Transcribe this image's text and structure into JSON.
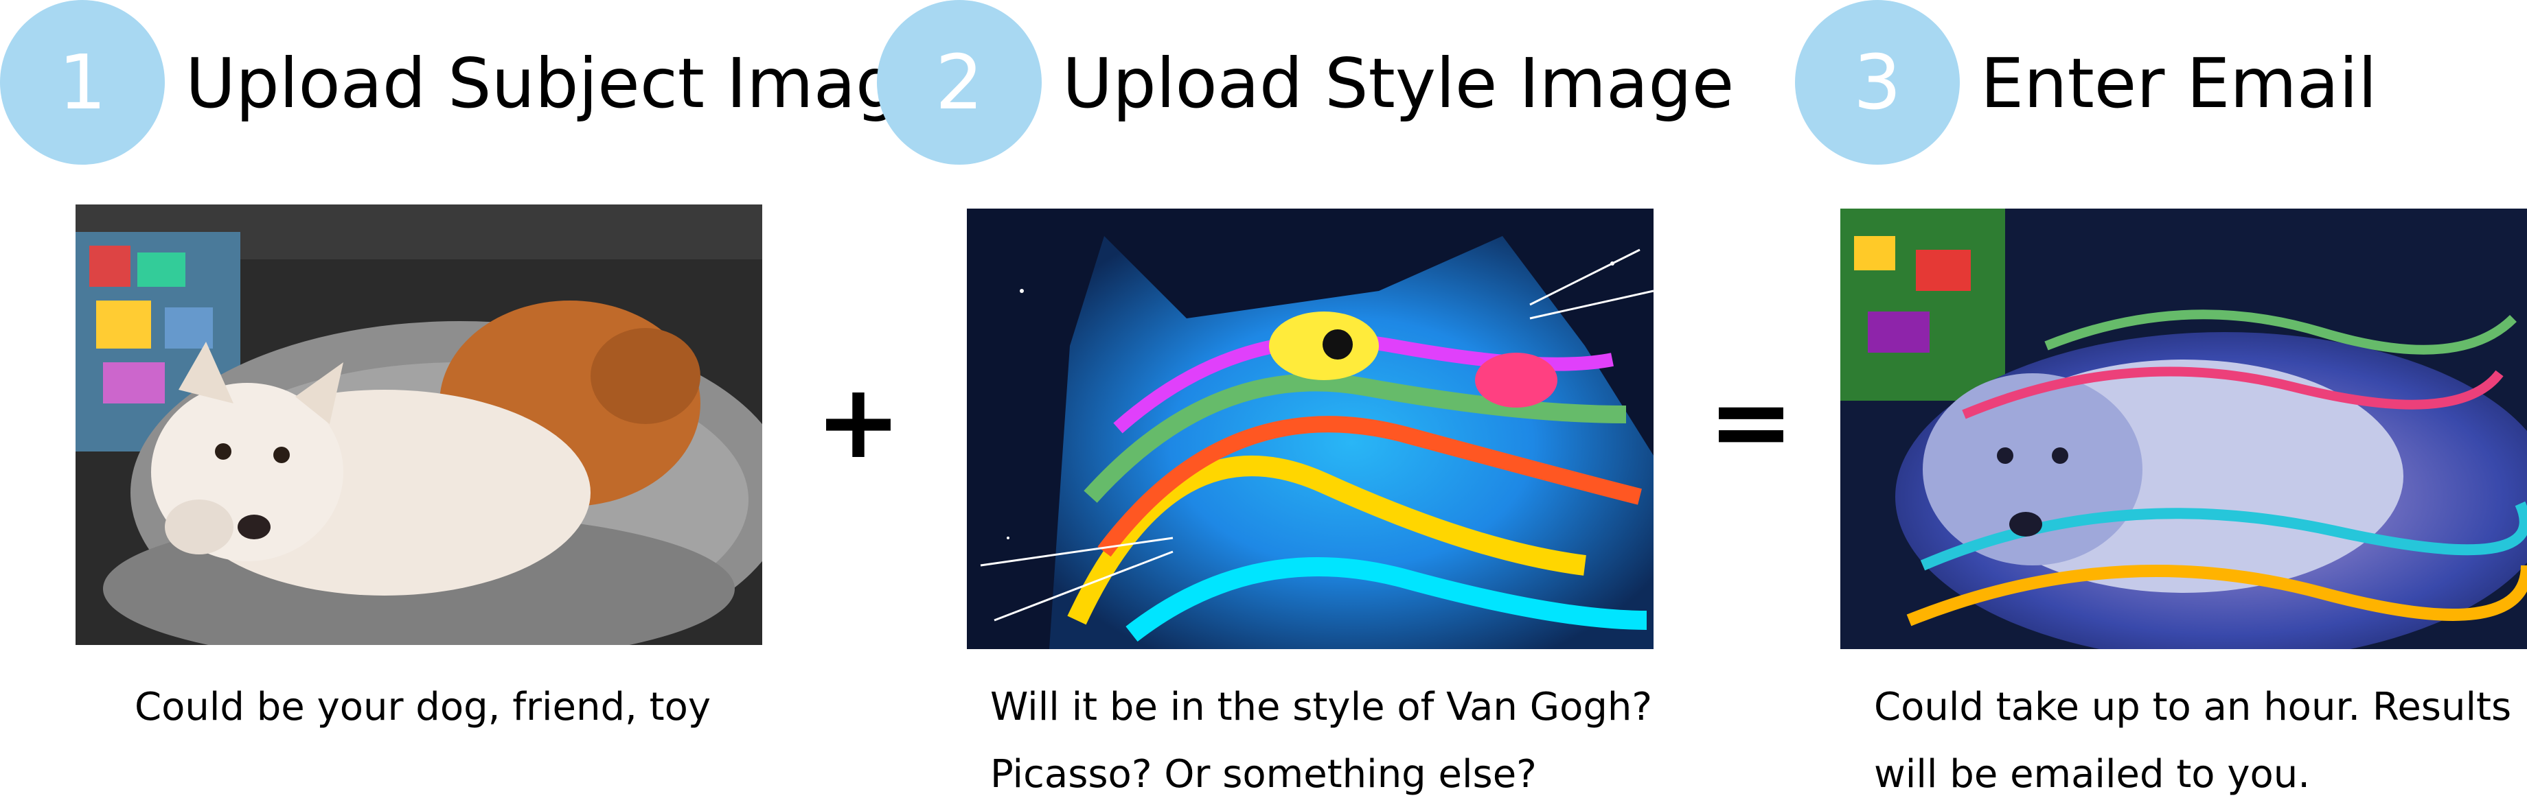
{
  "steps": [
    {
      "number": "1",
      "title": "Upload Subject Image",
      "caption_lines": [
        "Could be your dog, friend, toy"
      ]
    },
    {
      "number": "2",
      "title": "Upload Style Image",
      "caption_lines": [
        "Will it be in the style of Van Gogh?",
        "Picasso? Or something else?"
      ]
    },
    {
      "number": "3",
      "title": "Enter Email",
      "caption_lines": [
        "Could take up to an hour. Results",
        "will be emailed to you."
      ]
    }
  ],
  "operators": {
    "plus": "+",
    "equals": "="
  },
  "colors": {
    "circle": "#a8d8f2",
    "text": "#000000"
  }
}
